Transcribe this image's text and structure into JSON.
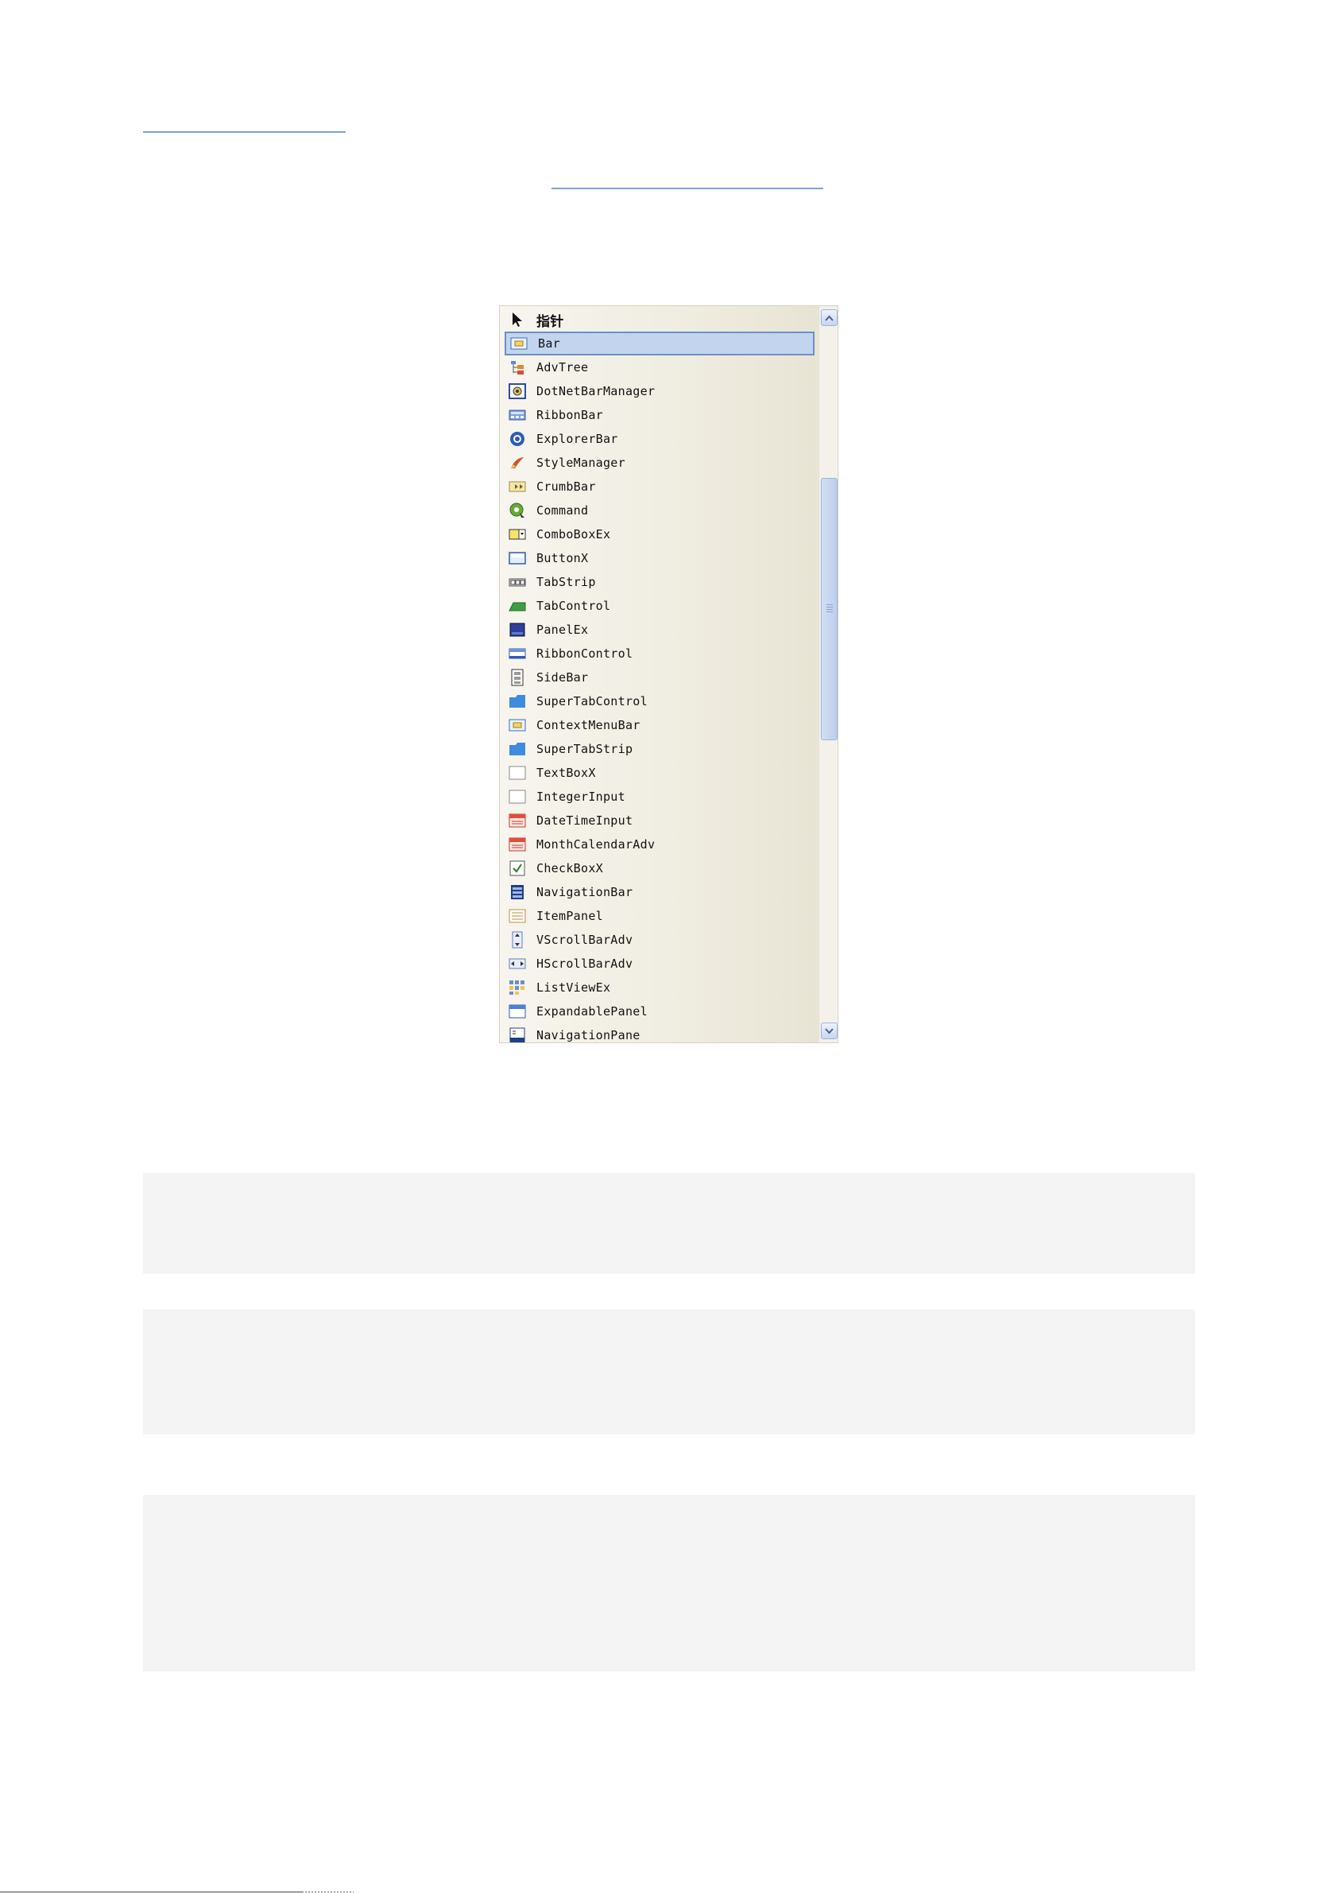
{
  "toolbox": {
    "items": [
      {
        "label": "指针",
        "icon": "pointer-arrow-icon"
      },
      {
        "label": "Bar",
        "icon": "bar-icon",
        "selected": true
      },
      {
        "label": "AdvTree",
        "icon": "adv-tree-icon"
      },
      {
        "label": "DotNetBarManager",
        "icon": "dotnetbar-manager-icon"
      },
      {
        "label": "RibbonBar",
        "icon": "ribbon-bar-icon"
      },
      {
        "label": "ExplorerBar",
        "icon": "explorer-bar-icon"
      },
      {
        "label": "StyleManager",
        "icon": "style-manager-icon"
      },
      {
        "label": "CrumbBar",
        "icon": "crumb-bar-icon"
      },
      {
        "label": "Command",
        "icon": "command-icon"
      },
      {
        "label": "ComboBoxEx",
        "icon": "combo-box-icon"
      },
      {
        "label": "ButtonX",
        "icon": "button-icon"
      },
      {
        "label": "TabStrip",
        "icon": "tab-strip-icon"
      },
      {
        "label": "TabControl",
        "icon": "tab-control-icon"
      },
      {
        "label": "PanelEx",
        "icon": "panel-icon"
      },
      {
        "label": "RibbonControl",
        "icon": "ribbon-control-icon"
      },
      {
        "label": "SideBar",
        "icon": "side-bar-icon"
      },
      {
        "label": "SuperTabControl",
        "icon": "super-tab-control-icon"
      },
      {
        "label": "ContextMenuBar",
        "icon": "context-menu-bar-icon"
      },
      {
        "label": "SuperTabStrip",
        "icon": "super-tab-strip-icon"
      },
      {
        "label": "TextBoxX",
        "icon": "text-box-icon"
      },
      {
        "label": "IntegerInput",
        "icon": "integer-input-icon"
      },
      {
        "label": "DateTimeInput",
        "icon": "date-time-input-icon"
      },
      {
        "label": "MonthCalendarAdv",
        "icon": "month-calendar-icon"
      },
      {
        "label": "CheckBoxX",
        "icon": "check-box-icon"
      },
      {
        "label": "NavigationBar",
        "icon": "navigation-bar-icon"
      },
      {
        "label": "ItemPanel",
        "icon": "item-panel-icon"
      },
      {
        "label": "VScrollBarAdv",
        "icon": "vscrollbar-icon"
      },
      {
        "label": "HScrollBarAdv",
        "icon": "hscrollbar-icon"
      },
      {
        "label": "ListViewEx",
        "icon": "list-view-icon"
      },
      {
        "label": "ExpandablePanel",
        "icon": "expandable-panel-icon"
      },
      {
        "label": "NavigationPane",
        "icon": "navigation-pane-icon"
      }
    ]
  }
}
